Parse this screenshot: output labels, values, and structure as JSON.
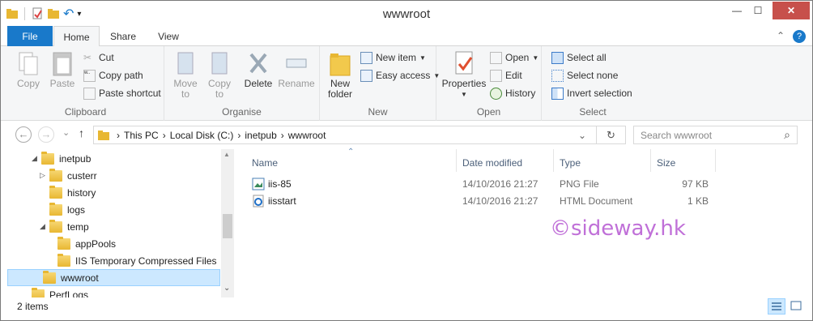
{
  "window": {
    "title": "wwwroot",
    "minimize": "—",
    "maximize": "☐",
    "close": "✕"
  },
  "qat": {
    "undo_icon": "↶",
    "dropdown": "▾"
  },
  "tabs": [
    {
      "label": "File"
    },
    {
      "label": "Home"
    },
    {
      "label": "Share"
    },
    {
      "label": "View"
    }
  ],
  "tabs_right": {
    "chev": "⌃",
    "help": "?"
  },
  "ribbon": {
    "clipboard": {
      "label": "Clipboard",
      "copy": "Copy",
      "paste": "Paste",
      "cut": "Cut",
      "copy_path": "Copy path",
      "paste_shortcut": "Paste shortcut"
    },
    "organise": {
      "label": "Organise",
      "move_to": "Move",
      "move_to2": "to",
      "copy_to": "Copy",
      "copy_to2": "to",
      "delete": "Delete",
      "rename": "Rename"
    },
    "new": {
      "label": "New",
      "new_folder": "New",
      "new_folder2": "folder",
      "new_item": "New item",
      "easy_access": "Easy access"
    },
    "open": {
      "label": "Open",
      "properties": "Properties",
      "open": "Open",
      "edit": "Edit",
      "history": "History"
    },
    "select": {
      "label": "Select",
      "select_all": "Select all",
      "select_none": "Select none",
      "invert": "Invert selection"
    }
  },
  "nav": {
    "back": "←",
    "forward": "→",
    "down": "⌄",
    "up": "↑",
    "refresh": "↻",
    "dropdown": "⌄"
  },
  "breadcrumb": [
    "This PC",
    "Local Disk (C:)",
    "inetpub",
    "wwwroot"
  ],
  "breadcrumb_sep": "›",
  "search": {
    "placeholder": "Search wwwroot",
    "icon": "⌕"
  },
  "tree": [
    {
      "label": "inetpub",
      "expander": "◢"
    },
    {
      "label": "custerr",
      "expander": "▷"
    },
    {
      "label": "history",
      "expander": ""
    },
    {
      "label": "logs",
      "expander": ""
    },
    {
      "label": "temp",
      "expander": "◢"
    },
    {
      "label": "appPools",
      "expander": ""
    },
    {
      "label": "IIS Temporary Compressed Files",
      "expander": ""
    },
    {
      "label": "wwwroot",
      "expander": ""
    },
    {
      "label": "PerfLogs",
      "expander": ""
    }
  ],
  "scroll": {
    "up": "▲",
    "down": "⌄"
  },
  "columns": {
    "name": "Name",
    "date": "Date modified",
    "type": "Type",
    "size": "Size",
    "sort_arrow": "⌃"
  },
  "files": [
    {
      "name": "iis-85",
      "date": "14/10/2016 21:27",
      "type": "PNG File",
      "size": "97 KB",
      "icon": "image-file-icon"
    },
    {
      "name": "iisstart",
      "date": "14/10/2016 21:27",
      "type": "HTML Document",
      "size": "1 KB",
      "icon": "html-file-icon"
    }
  ],
  "status": {
    "count": "2 items"
  },
  "watermark": "©sideway.hk",
  "colors": {
    "accent": "#1979ca",
    "close": "#c7504b",
    "selection": "#cce8ff"
  }
}
